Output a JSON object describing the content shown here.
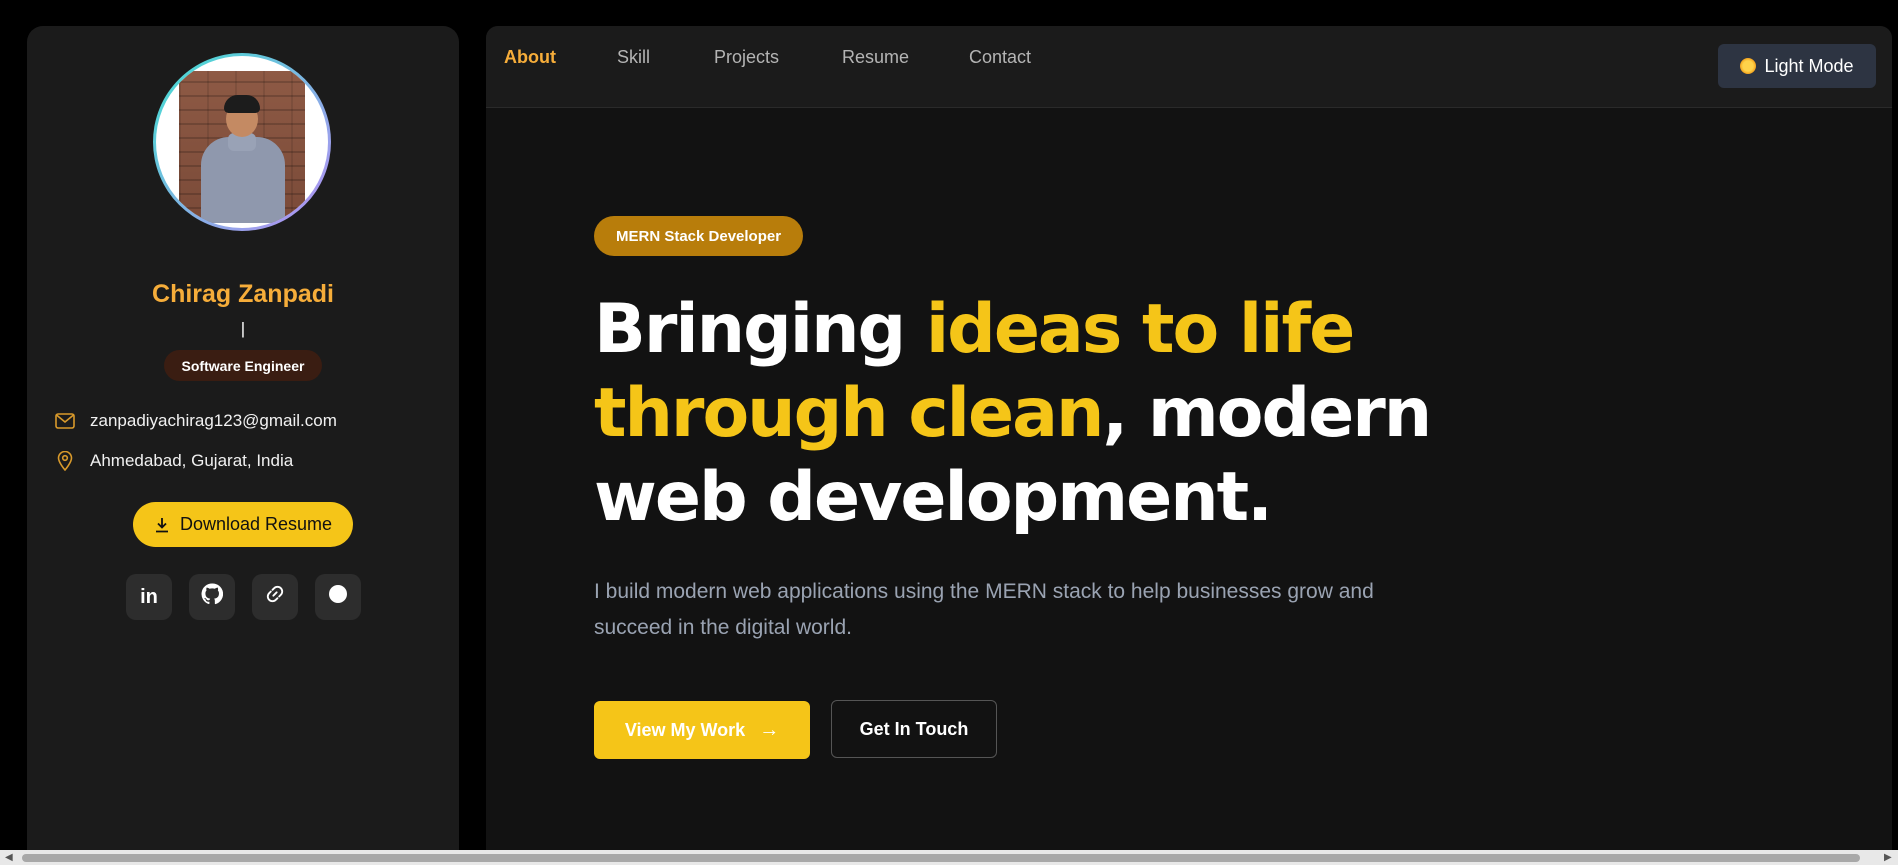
{
  "profile": {
    "name": "Chirag Zanpadi",
    "cursor": "|",
    "role": "Software Engineer",
    "email": "zanpadiyachirag123@gmail.com",
    "location": "Ahmedabad, Gujarat, India",
    "download_label": "Download Resume",
    "socials": [
      {
        "icon": "linkedin-icon",
        "glyph": "in"
      },
      {
        "icon": "github-icon",
        "glyph": ""
      },
      {
        "icon": "link-icon",
        "glyph": "🔗"
      },
      {
        "icon": "circle-icon",
        "glyph": ""
      }
    ]
  },
  "nav": {
    "items": [
      {
        "label": "About",
        "active": true
      },
      {
        "label": "Skill",
        "active": false
      },
      {
        "label": "Projects",
        "active": false
      },
      {
        "label": "Resume",
        "active": false
      },
      {
        "label": "Contact",
        "active": false
      }
    ],
    "theme_toggle": "Light Mode"
  },
  "hero": {
    "badge": "MERN Stack Developer",
    "headline_part1": "Bringing ",
    "headline_highlight": "ideas to life through clean",
    "headline_part2": ", modern web development.",
    "description": "I build modern web applications using the MERN stack to help businesses grow and succeed in the digital world.",
    "primary_cta": "View My Work",
    "primary_arrow": "→",
    "secondary_cta": "Get In Touch"
  },
  "colors": {
    "accent_yellow": "#f5c518",
    "accent_orange": "#f6ad3a",
    "background": "#121212",
    "sidebar": "#1b1b1b"
  }
}
